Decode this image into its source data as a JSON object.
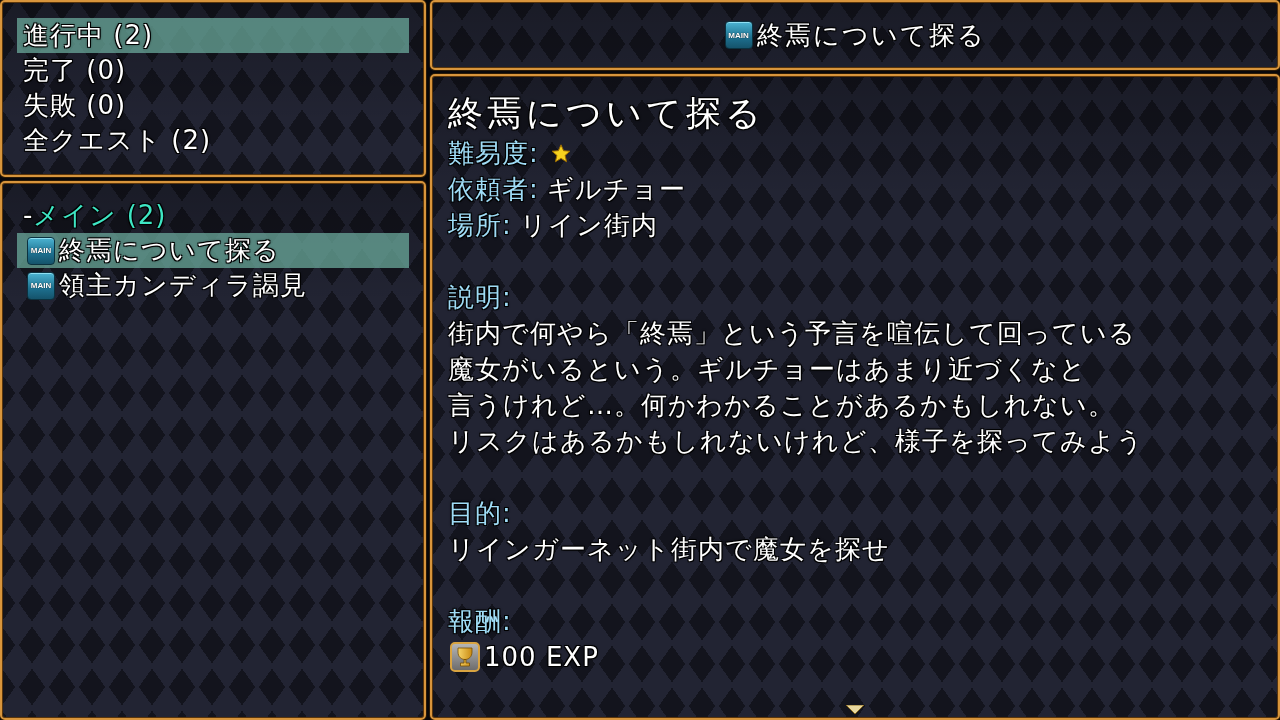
{
  "categories": [
    {
      "label": "進行中 (2)",
      "selected": true
    },
    {
      "label": "完了 (0)",
      "selected": false
    },
    {
      "label": "失敗 (0)",
      "selected": false
    },
    {
      "label": "全クエスト (2)",
      "selected": false
    }
  ],
  "quest_groups": [
    {
      "marker": "-",
      "label": "メイン (2)",
      "children": [
        {
          "tag": "MAIN",
          "title": "終焉について探る",
          "selected": true
        },
        {
          "tag": "MAIN",
          "title": "領主カンディラ謁見",
          "selected": false
        }
      ]
    }
  ],
  "header": {
    "tag": "MAIN",
    "title": "終焉について探る"
  },
  "details": {
    "title": "終焉について探る",
    "fields": [
      {
        "kind": "stars",
        "label": "難易度:",
        "stars": 1
      },
      {
        "kind": "text",
        "label": "依頼者:",
        "value": "ギルチョー"
      },
      {
        "kind": "text",
        "label": "場所:",
        "value": "リイン街内"
      }
    ],
    "sections": [
      {
        "kind": "description",
        "label": "説明:",
        "lines": [
          "街内で何やら「終焉」という予言を喧伝して回っている",
          "魔女がいるという。ギルチョーはあまり近づくなと",
          "言うけれど…。何かわかることがあるかもしれない。",
          "リスクはあるかもしれないけれど、様子を探ってみよう"
        ]
      },
      {
        "kind": "objective",
        "label": "目的:",
        "lines": [
          "リインガーネット街内で魔女を探せ"
        ]
      },
      {
        "kind": "rewards",
        "label": "報酬:",
        "rewards": [
          {
            "kind": "trophy",
            "text": "100 EXP"
          }
        ]
      }
    ],
    "more_below": true
  }
}
